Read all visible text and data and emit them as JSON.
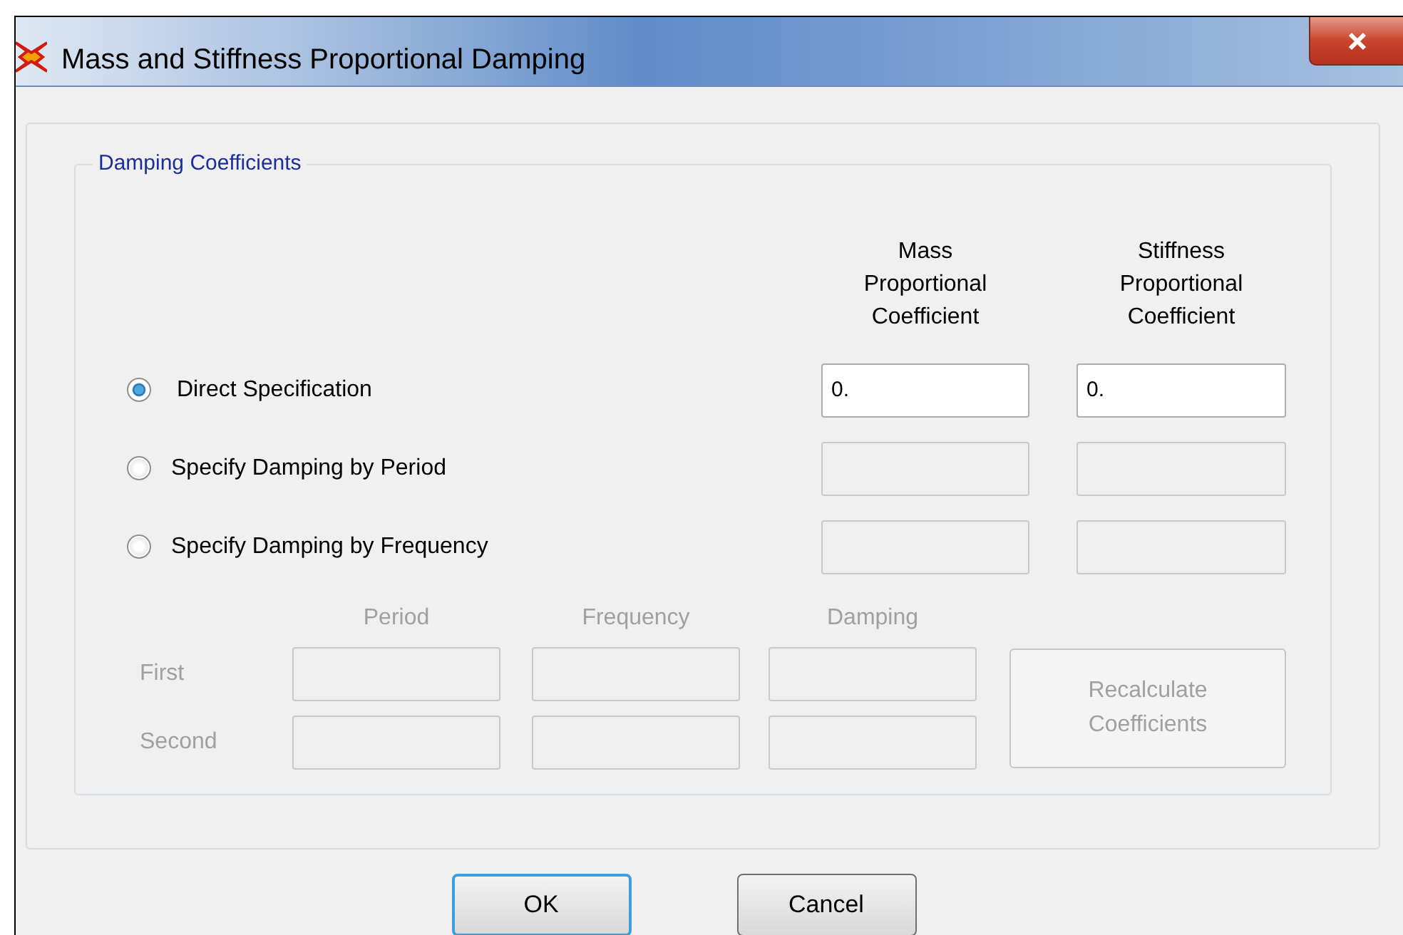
{
  "window": {
    "title": "Mass and Stiffness Proportional Damping"
  },
  "group": {
    "title": "Damping Coefficients",
    "columns": [
      "Mass Proportional Coefficient",
      "Stiffness Proportional Coefficient"
    ],
    "options": [
      {
        "label": "Direct Specification",
        "selected": true,
        "fields_enabled": true,
        "mass_value": "0.",
        "stiffness_value": "0."
      },
      {
        "label": "Specify Damping by Period",
        "selected": false,
        "fields_enabled": false
      },
      {
        "label": "Specify Damping by Frequency",
        "selected": false,
        "fields_enabled": false
      }
    ],
    "calculation": {
      "disabled": true,
      "columns": [
        "Period",
        "Frequency",
        "Damping"
      ],
      "rows": [
        "First",
        "Second"
      ],
      "button": "Recalculate Coefficients"
    }
  },
  "buttons": [
    {
      "label": "OK",
      "default": true
    },
    {
      "label": "Cancel",
      "default": false
    }
  ]
}
